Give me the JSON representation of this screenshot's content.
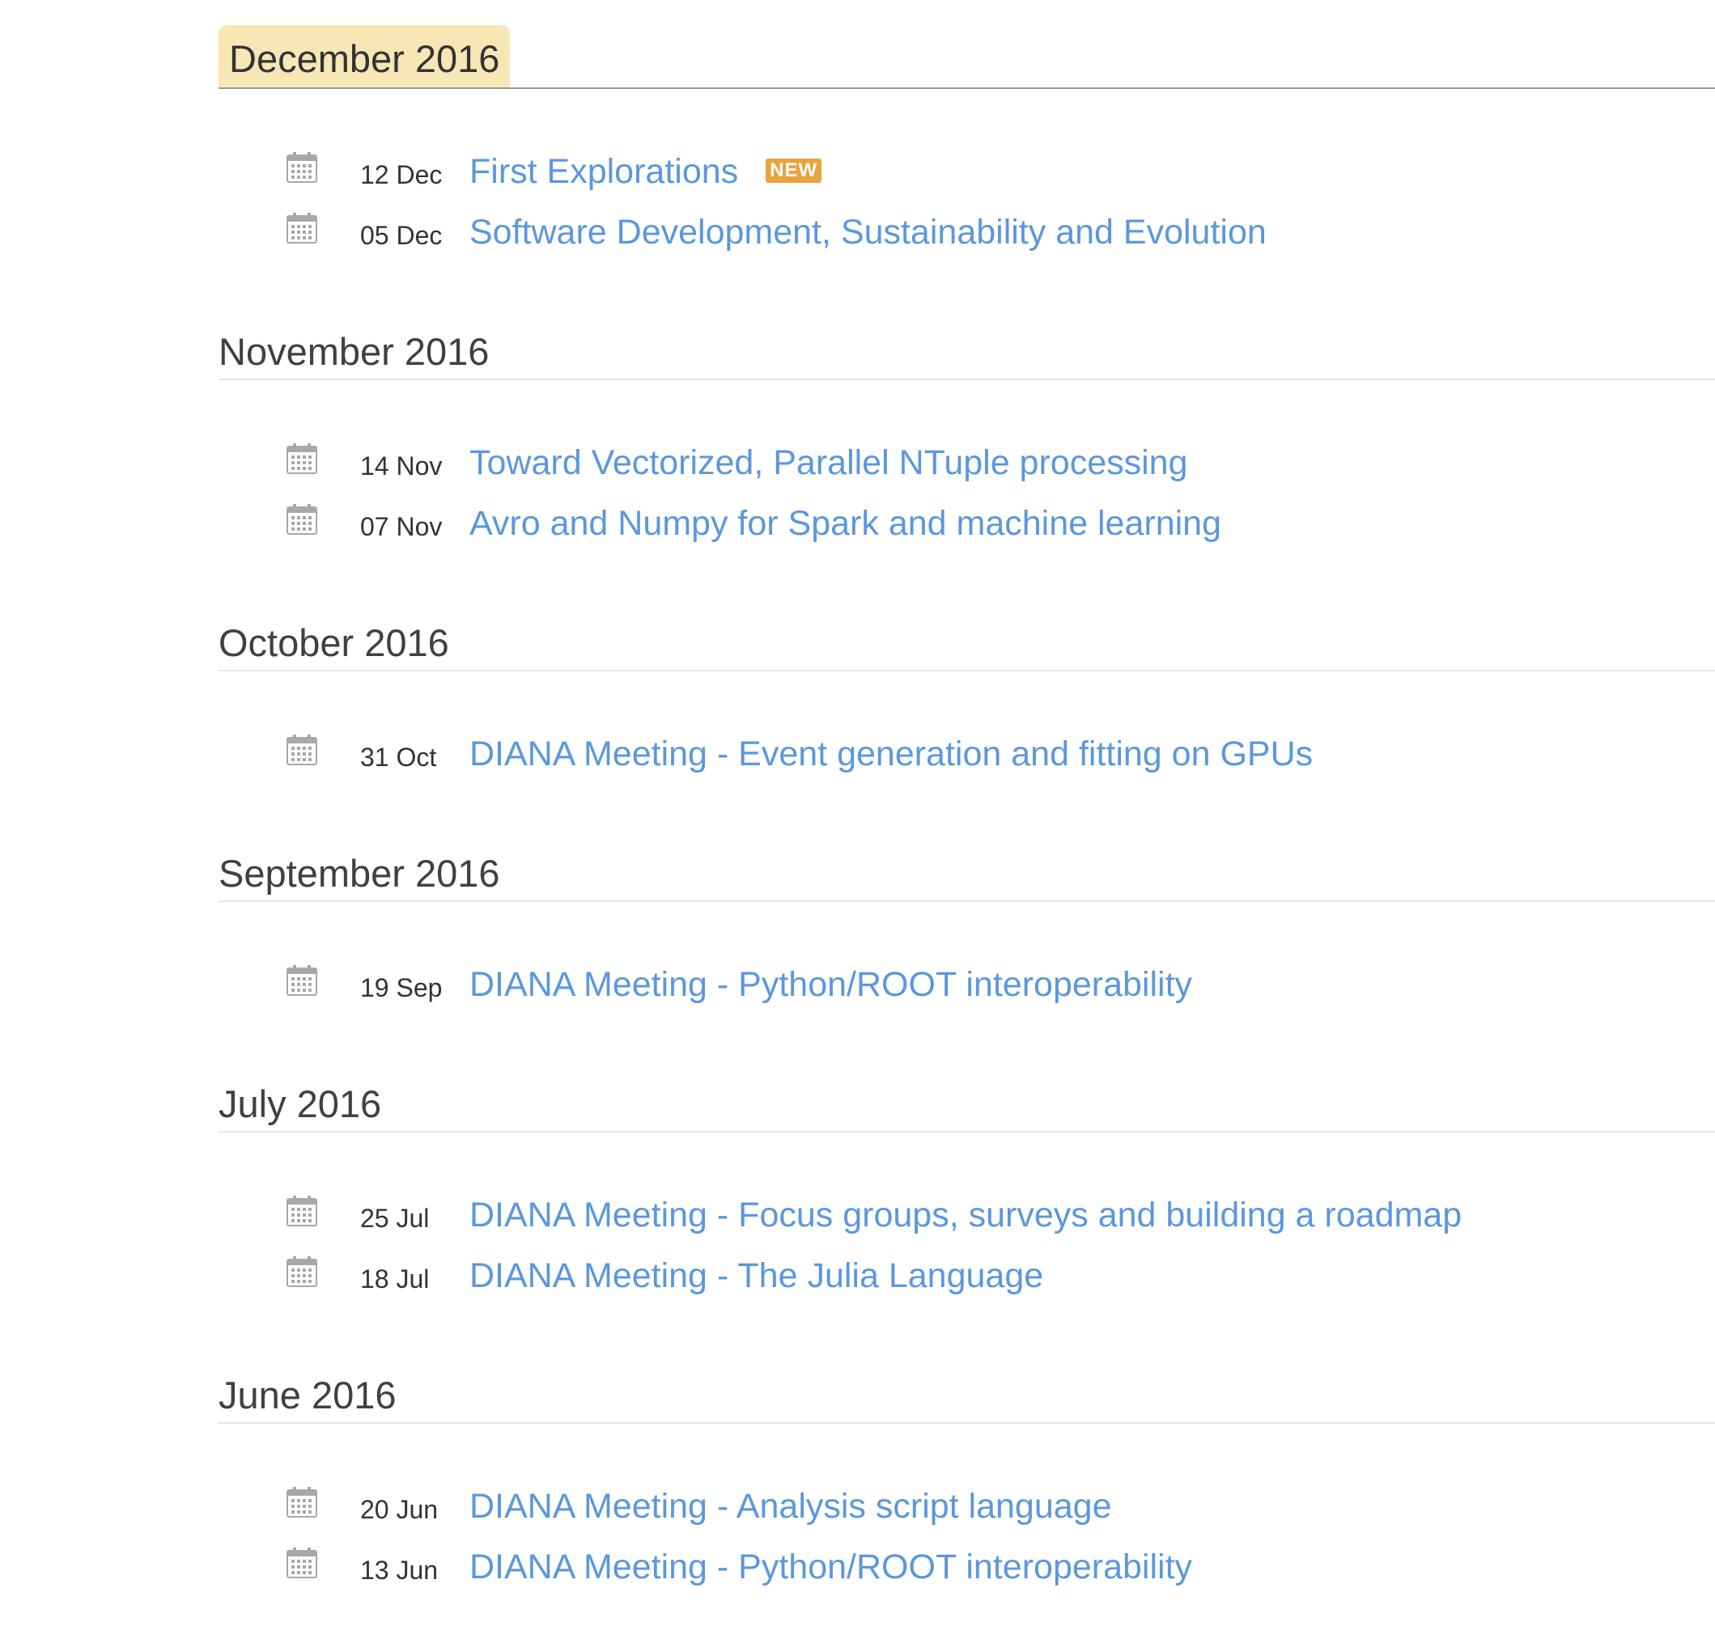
{
  "months": [
    {
      "title": "December 2016",
      "current": true,
      "events": [
        {
          "date": "12 Dec",
          "title": "First Explorations",
          "badge": "NEW"
        },
        {
          "date": "05 Dec",
          "title": "Software Development, Sustainability and Evolution"
        }
      ]
    },
    {
      "title": "November 2016",
      "events": [
        {
          "date": "14 Nov",
          "title": "Toward Vectorized, Parallel NTuple processing"
        },
        {
          "date": "07 Nov",
          "title": "Avro and Numpy for Spark and machine learning"
        }
      ]
    },
    {
      "title": "October 2016",
      "events": [
        {
          "date": "31 Oct",
          "title": "DIANA Meeting - Event generation and fitting on GPUs"
        }
      ]
    },
    {
      "title": "September 2016",
      "events": [
        {
          "date": "19 Sep",
          "title": "DIANA Meeting - Python/ROOT interoperability"
        }
      ]
    },
    {
      "title": "July 2016",
      "events": [
        {
          "date": "25 Jul",
          "title": "DIANA Meeting - Focus groups, surveys and building a roadmap"
        },
        {
          "date": "18 Jul",
          "title": "DIANA Meeting - The Julia Language"
        }
      ]
    },
    {
      "title": "June 2016",
      "events": [
        {
          "date": "20 Jun",
          "title": "DIANA Meeting - Analysis script language"
        },
        {
          "date": "13 Jun",
          "title": "DIANA Meeting - Python/ROOT interoperability"
        }
      ]
    }
  ],
  "icons": {
    "event_icon": "calendar-icon"
  },
  "colors": {
    "link": "#5b97dd",
    "current_month_tab": "#f6e7b5",
    "new_badge": "#e8a33d",
    "icon_gray": "#a8a8a8"
  }
}
